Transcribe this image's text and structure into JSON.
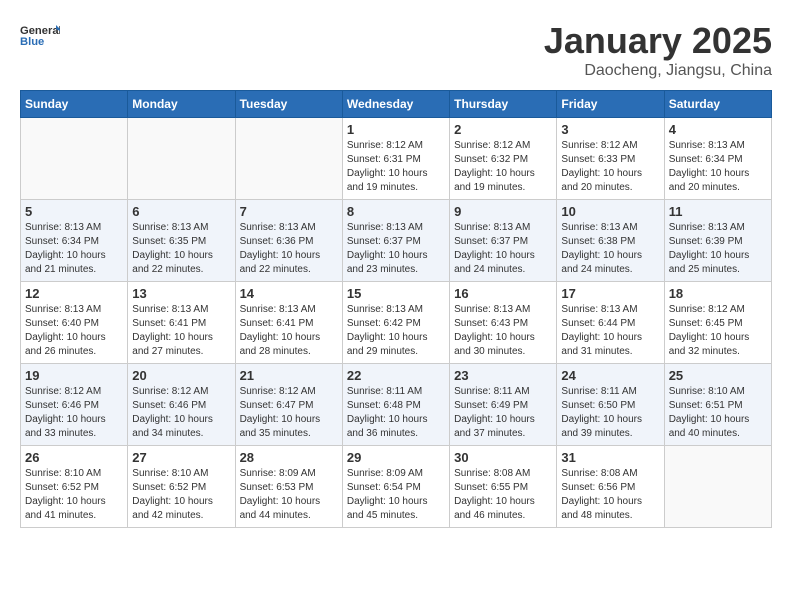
{
  "header": {
    "logo_general": "General",
    "logo_blue": "Blue",
    "month_title": "January 2025",
    "location": "Daocheng, Jiangsu, China"
  },
  "weekdays": [
    "Sunday",
    "Monday",
    "Tuesday",
    "Wednesday",
    "Thursday",
    "Friday",
    "Saturday"
  ],
  "weeks": [
    [
      {
        "day": "",
        "info": ""
      },
      {
        "day": "",
        "info": ""
      },
      {
        "day": "",
        "info": ""
      },
      {
        "day": "1",
        "info": "Sunrise: 8:12 AM\nSunset: 6:31 PM\nDaylight: 10 hours\nand 19 minutes."
      },
      {
        "day": "2",
        "info": "Sunrise: 8:12 AM\nSunset: 6:32 PM\nDaylight: 10 hours\nand 19 minutes."
      },
      {
        "day": "3",
        "info": "Sunrise: 8:12 AM\nSunset: 6:33 PM\nDaylight: 10 hours\nand 20 minutes."
      },
      {
        "day": "4",
        "info": "Sunrise: 8:13 AM\nSunset: 6:34 PM\nDaylight: 10 hours\nand 20 minutes."
      }
    ],
    [
      {
        "day": "5",
        "info": "Sunrise: 8:13 AM\nSunset: 6:34 PM\nDaylight: 10 hours\nand 21 minutes."
      },
      {
        "day": "6",
        "info": "Sunrise: 8:13 AM\nSunset: 6:35 PM\nDaylight: 10 hours\nand 22 minutes."
      },
      {
        "day": "7",
        "info": "Sunrise: 8:13 AM\nSunset: 6:36 PM\nDaylight: 10 hours\nand 22 minutes."
      },
      {
        "day": "8",
        "info": "Sunrise: 8:13 AM\nSunset: 6:37 PM\nDaylight: 10 hours\nand 23 minutes."
      },
      {
        "day": "9",
        "info": "Sunrise: 8:13 AM\nSunset: 6:37 PM\nDaylight: 10 hours\nand 24 minutes."
      },
      {
        "day": "10",
        "info": "Sunrise: 8:13 AM\nSunset: 6:38 PM\nDaylight: 10 hours\nand 24 minutes."
      },
      {
        "day": "11",
        "info": "Sunrise: 8:13 AM\nSunset: 6:39 PM\nDaylight: 10 hours\nand 25 minutes."
      }
    ],
    [
      {
        "day": "12",
        "info": "Sunrise: 8:13 AM\nSunset: 6:40 PM\nDaylight: 10 hours\nand 26 minutes."
      },
      {
        "day": "13",
        "info": "Sunrise: 8:13 AM\nSunset: 6:41 PM\nDaylight: 10 hours\nand 27 minutes."
      },
      {
        "day": "14",
        "info": "Sunrise: 8:13 AM\nSunset: 6:41 PM\nDaylight: 10 hours\nand 28 minutes."
      },
      {
        "day": "15",
        "info": "Sunrise: 8:13 AM\nSunset: 6:42 PM\nDaylight: 10 hours\nand 29 minutes."
      },
      {
        "day": "16",
        "info": "Sunrise: 8:13 AM\nSunset: 6:43 PM\nDaylight: 10 hours\nand 30 minutes."
      },
      {
        "day": "17",
        "info": "Sunrise: 8:13 AM\nSunset: 6:44 PM\nDaylight: 10 hours\nand 31 minutes."
      },
      {
        "day": "18",
        "info": "Sunrise: 8:12 AM\nSunset: 6:45 PM\nDaylight: 10 hours\nand 32 minutes."
      }
    ],
    [
      {
        "day": "19",
        "info": "Sunrise: 8:12 AM\nSunset: 6:46 PM\nDaylight: 10 hours\nand 33 minutes."
      },
      {
        "day": "20",
        "info": "Sunrise: 8:12 AM\nSunset: 6:46 PM\nDaylight: 10 hours\nand 34 minutes."
      },
      {
        "day": "21",
        "info": "Sunrise: 8:12 AM\nSunset: 6:47 PM\nDaylight: 10 hours\nand 35 minutes."
      },
      {
        "day": "22",
        "info": "Sunrise: 8:11 AM\nSunset: 6:48 PM\nDaylight: 10 hours\nand 36 minutes."
      },
      {
        "day": "23",
        "info": "Sunrise: 8:11 AM\nSunset: 6:49 PM\nDaylight: 10 hours\nand 37 minutes."
      },
      {
        "day": "24",
        "info": "Sunrise: 8:11 AM\nSunset: 6:50 PM\nDaylight: 10 hours\nand 39 minutes."
      },
      {
        "day": "25",
        "info": "Sunrise: 8:10 AM\nSunset: 6:51 PM\nDaylight: 10 hours\nand 40 minutes."
      }
    ],
    [
      {
        "day": "26",
        "info": "Sunrise: 8:10 AM\nSunset: 6:52 PM\nDaylight: 10 hours\nand 41 minutes."
      },
      {
        "day": "27",
        "info": "Sunrise: 8:10 AM\nSunset: 6:52 PM\nDaylight: 10 hours\nand 42 minutes."
      },
      {
        "day": "28",
        "info": "Sunrise: 8:09 AM\nSunset: 6:53 PM\nDaylight: 10 hours\nand 44 minutes."
      },
      {
        "day": "29",
        "info": "Sunrise: 8:09 AM\nSunset: 6:54 PM\nDaylight: 10 hours\nand 45 minutes."
      },
      {
        "day": "30",
        "info": "Sunrise: 8:08 AM\nSunset: 6:55 PM\nDaylight: 10 hours\nand 46 minutes."
      },
      {
        "day": "31",
        "info": "Sunrise: 8:08 AM\nSunset: 6:56 PM\nDaylight: 10 hours\nand 48 minutes."
      },
      {
        "day": "",
        "info": ""
      }
    ]
  ]
}
